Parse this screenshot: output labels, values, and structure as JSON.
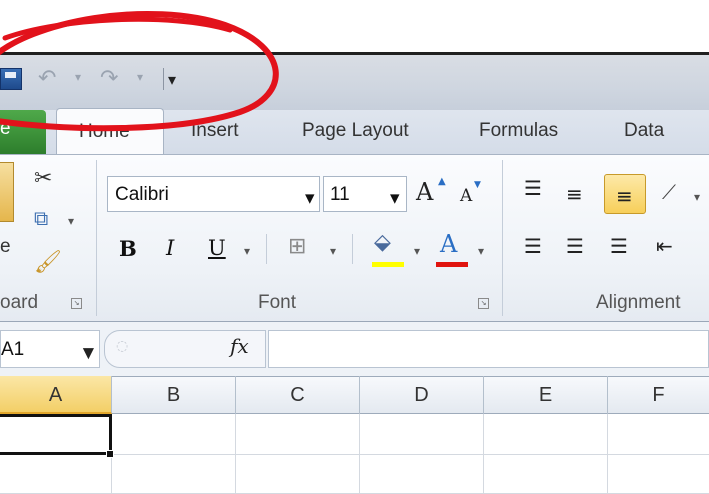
{
  "quick_access": {
    "undo_icon": "undo-arrow",
    "redo_icon": "redo-arrow",
    "save_icon": "floppy-disk",
    "customize_glyph": "▾"
  },
  "tabs": {
    "file": "e",
    "home": "Home",
    "insert": "Insert",
    "page_layout": "Page Layout",
    "formulas": "Formulas",
    "data": "Data"
  },
  "clipboard": {
    "label": "oard",
    "paste_label": "e"
  },
  "font": {
    "group_label": "Font",
    "font_name": "Calibri",
    "font_size": "11",
    "bold": "B",
    "italic": "I",
    "underline": "U",
    "grow": "A",
    "shrink": "A",
    "fill_color": "#ffff00",
    "font_color": "#e0140f"
  },
  "alignment": {
    "group_label": "Alignment"
  },
  "formula_bar": {
    "name_box": "A1",
    "fx": "fx",
    "formula": ""
  },
  "grid": {
    "columns": [
      "A",
      "B",
      "C",
      "D",
      "E",
      "F"
    ],
    "selected_column": "A",
    "active_cell": "A1"
  },
  "colors": {
    "annotation": "#e2121b",
    "file_tab": "#2d7e2c",
    "selection_header": "#f3cf67"
  }
}
